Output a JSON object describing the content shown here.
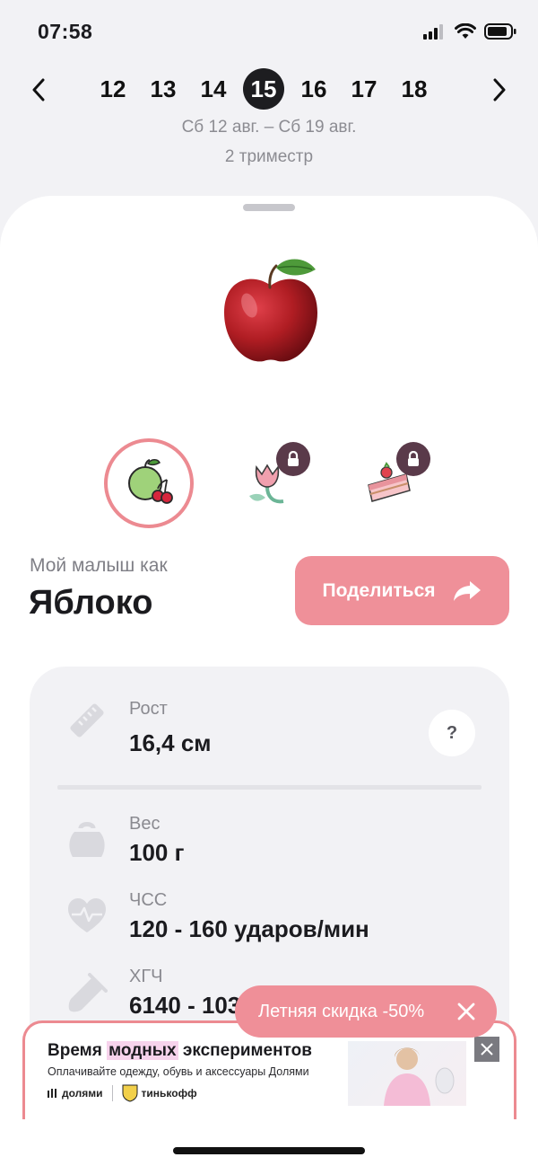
{
  "status_bar": {
    "time": "07:58"
  },
  "week_nav": {
    "weeks": [
      "12",
      "13",
      "14",
      "15",
      "16",
      "17",
      "18"
    ],
    "selected": "15",
    "date_range": "Сб 12 авг. – Сб 19 авг.",
    "trimester": "2 триместр"
  },
  "baby": {
    "caption": "Мой малыш как",
    "fruit_name": "Яблоко",
    "share_label": "Поделиться",
    "modes": [
      {
        "name": "fruits",
        "icon": "apple-cherry-icon",
        "locked": false
      },
      {
        "name": "flowers",
        "icon": "tulip-icon",
        "locked": true
      },
      {
        "name": "desserts",
        "icon": "cake-icon",
        "locked": true
      }
    ]
  },
  "stats": {
    "height": {
      "label": "Рост",
      "value": "16,4 см",
      "icon": "ruler-icon"
    },
    "weight": {
      "label": "Вес",
      "value": "100 г",
      "icon": "weight-icon"
    },
    "heart_rate": {
      "label": "ЧСС",
      "value": "120 - 160 ударов/мин",
      "icon": "heart-pulse-icon"
    },
    "hcg": {
      "label": "ХГЧ",
      "value": "6140 - 103",
      "icon": "test-tube-icon"
    },
    "help_label": "?"
  },
  "promo": {
    "label": "Летняя скидка -50%"
  },
  "ad": {
    "title_pre": "Время ",
    "title_hl": "модных",
    "title_post": " экспериментов",
    "subtitle": "Оплачивайте одежду, обувь и аксессуары Долями",
    "brand1": "долями",
    "brand2": "тинькофф"
  },
  "colors": {
    "accent": "#ef9099",
    "dark": "#1d1d20",
    "card": "#f2f2f5",
    "lock": "#5a3a4a"
  }
}
